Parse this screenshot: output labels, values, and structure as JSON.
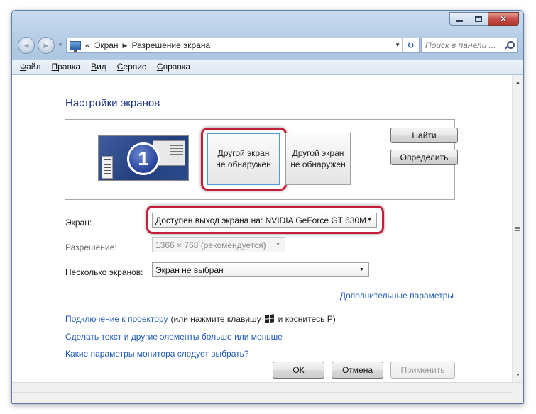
{
  "window": {
    "caption_buttons": [
      "minimize-icon",
      "maximize-icon",
      "close-icon"
    ],
    "close_glyph": "✕"
  },
  "nav": {
    "back_glyph": "◀",
    "forward_glyph": "▶",
    "breadcrumb_prefix": "«",
    "breadcrumb": [
      "Экран",
      "Разрешение экрана"
    ],
    "breadcrumb_sep": "▶",
    "refresh_glyph": "↻",
    "search_placeholder": "Поиск в панели ..."
  },
  "menubar": {
    "items": [
      {
        "hot": "Ф",
        "rest": "айл"
      },
      {
        "hot": "П",
        "rest": "равка"
      },
      {
        "hot": "В",
        "rest": "ид"
      },
      {
        "hot": "С",
        "rest": "ервис"
      },
      {
        "hot": "С",
        "rest": "правка"
      }
    ]
  },
  "main": {
    "title": "Настройки экранов",
    "monitors": {
      "primary_number": "1",
      "second_line1": "Другой экран",
      "second_line2": "не обнаружен",
      "third_line1": "Другой экран",
      "third_line2": "не обнаружен"
    },
    "find_button": "Найти",
    "detect_button": "Определить",
    "screen_label": "Экран:",
    "screen_value": "Доступен выход экрана на: NVIDIA GeForce GT 630M",
    "resolution_label": "Разрешение:",
    "resolution_value": "1366 × 768 (рекомендуется)",
    "multi_label": "Несколько экранов:",
    "multi_value": "Экран не выбран",
    "advanced_link": "Дополнительные параметры",
    "projector_link": "Подключение к проектору",
    "projector_hint_before": "(или нажмите клавишу",
    "projector_hint_after": "и коснитесь P)",
    "text_size_link": "Сделать текст и другие элементы больше или меньше",
    "monitor_help_link": "Какие параметры монитора следует выбрать?",
    "ok_button": "ОК",
    "cancel_button": "Отмена",
    "apply_button": "Применить"
  },
  "colors": {
    "title": "#1e3287",
    "link": "#1e5bb7",
    "highlight": "#c41e3a"
  }
}
